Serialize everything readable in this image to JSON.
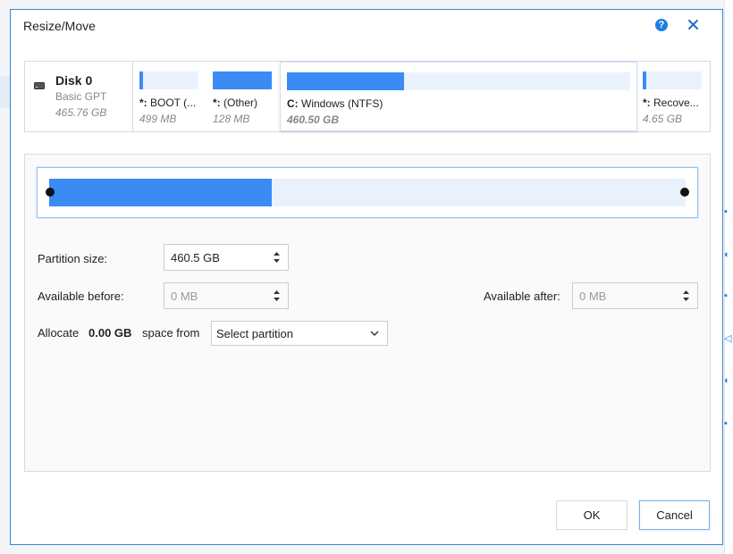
{
  "dialog": {
    "title": "Resize/Move",
    "help_icon_glyph": "?"
  },
  "disk": {
    "name": "Disk 0",
    "type": "Basic GPT",
    "size": "465.76 GB"
  },
  "partitions": [
    {
      "label_bold": "*:",
      "label_rest": " BOOT (...",
      "size": "499 MB",
      "used_fraction": 0.1
    },
    {
      "label_bold": "*:",
      "label_rest": "  (Other)",
      "size": "128 MB",
      "used_fraction": 1.0
    },
    {
      "label_bold": "C:",
      "label_rest": " Windows (NTFS)",
      "size": "460.50 GB",
      "used_fraction": 0.34,
      "selected": true
    },
    {
      "label_bold": "*:",
      "label_rest": " Recove...",
      "size": "4.65 GB",
      "used_fraction": 0.1
    }
  ],
  "resize": {
    "used_fraction": 0.35,
    "partition_size_label": "Partition size:",
    "partition_size_value": "460.5 GB",
    "available_before_label": "Available before:",
    "available_before_value": "0 MB",
    "available_after_label": "Available after:",
    "available_after_value": "0 MB",
    "allocate_label": "Allocate",
    "allocate_amount": "0.00 GB",
    "allocate_suffix": "space from",
    "allocate_select": "Select partition"
  },
  "buttons": {
    "ok": "OK",
    "cancel": "Cancel"
  },
  "colors": {
    "accent": "#3b8bf5",
    "track": "#eaf3fd",
    "dialog_border": "#3a86d8"
  }
}
